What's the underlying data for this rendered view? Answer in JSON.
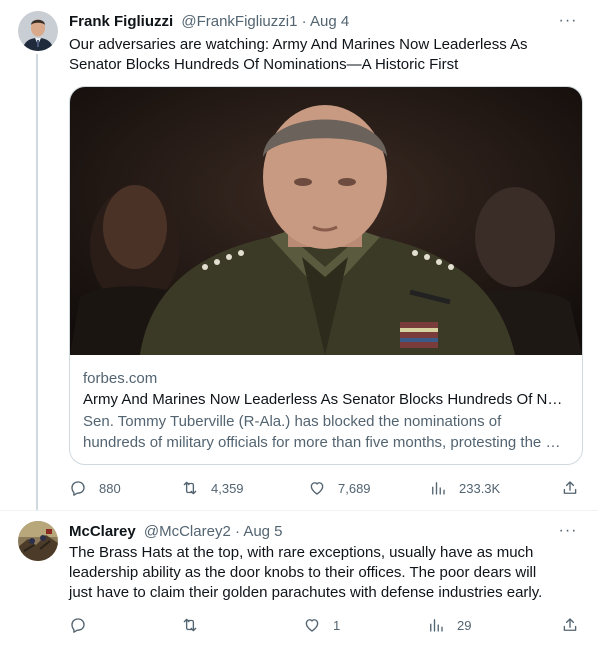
{
  "tweets": [
    {
      "name": "Frank Figliuzzi",
      "handle": "@FrankFigliuzzi1",
      "sep": " · ",
      "date": "Aug 4",
      "text": "Our adversaries are watching: Army And Marines Now Leaderless As\nSenator Blocks Hundreds Of Nominations—A Historic First",
      "card": {
        "domain": "forbes.com",
        "title": "Army And Marines Now Leaderless As Senator Blocks Hundreds Of Nominations—A Historic First",
        "desc_line1": "Sen. Tommy Tuberville (R-Ala.) has blocked the nominations of",
        "desc_line2": "hundreds of military officials for more than five months, protesting the Pentagon's abortion policy"
      },
      "actions": {
        "replies": "880",
        "retweets": "4,359",
        "likes": "7,689",
        "views": "233.3K"
      },
      "more_glyph": "···"
    },
    {
      "name": "McClarey",
      "handle": "@McClarey2",
      "sep": " · ",
      "date": "Aug 5",
      "text": "The Brass Hats at the top, with rare exceptions, usually have as much\nleadership ability as the door knobs to their offices.  The poor dears will\njust have to claim their golden parachutes with defense industries early.",
      "actions": {
        "replies": "",
        "retweets": "",
        "likes": "1",
        "views": "29"
      },
      "more_glyph": "···"
    }
  ],
  "icons": {
    "reply": "reply-icon",
    "retweet": "retweet-icon",
    "like": "heart-icon",
    "views": "views-icon",
    "share": "share-icon",
    "more": "more-icon"
  },
  "colors": {
    "text": "#0f1419",
    "secondary": "#536471",
    "border": "#cfd9de"
  }
}
